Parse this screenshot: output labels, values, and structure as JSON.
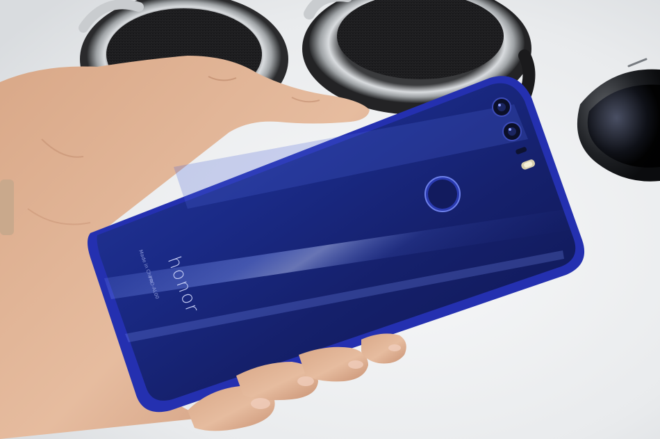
{
  "photo": {
    "phone": {
      "brand_logo": "honor",
      "regulatory_text": "Made in China",
      "model_code": "FRD-AL00"
    },
    "colors": {
      "background": "#eceef0",
      "phone_blue": "#1b2a8c",
      "phone_edge": "#2430b0",
      "skin": "#e2b596",
      "headphone_metal": "#b9bcbf",
      "headphone_dark": "#2a2a2c"
    }
  }
}
